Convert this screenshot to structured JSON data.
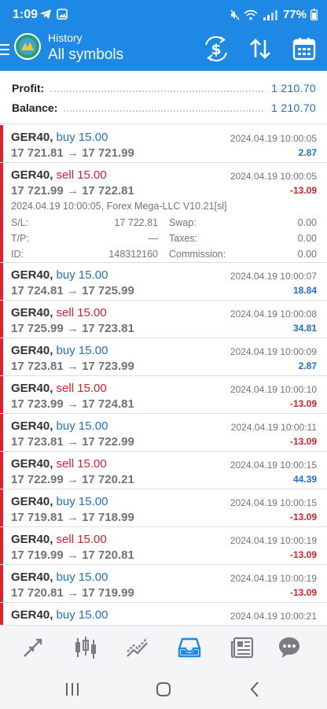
{
  "status_bar": {
    "time": "1:09",
    "battery": "77%"
  },
  "app_bar": {
    "section": "History",
    "title": "All symbols"
  },
  "summary": {
    "profit_label": "Profit:",
    "profit_value": "1 210.70",
    "balance_label": "Balance:",
    "balance_value": "1 210.70"
  },
  "deals": [
    {
      "symbol": "GER40,",
      "side": "buy 15.00",
      "prices": "17 721.81 → 17 721.99",
      "time": "2024.04.19 10:00:05",
      "profit": "2.87"
    },
    {
      "symbol": "GER40,",
      "side": "sell 15.00",
      "prices": "17 721.99 → 17 722.81",
      "time": "2024.04.19 10:00:05",
      "profit": "-13.09",
      "details": {
        "info": "2024.04.19 10:00:05, Forex Mega-LLC V10.21[sl]",
        "sl_label": "S/L:",
        "sl_value": "17 722.81",
        "tp_label": "T/P:",
        "tp_value": "—",
        "id_label": "ID:",
        "id_value": "148312160",
        "swap_label": "Swap:",
        "swap_value": "0.00",
        "taxes_label": "Taxes:",
        "taxes_value": "0.00",
        "commission_label": "Commission:",
        "commission_value": "0.00"
      }
    },
    {
      "symbol": "GER40,",
      "side": "buy 15.00",
      "prices": "17 724.81 → 17 725.99",
      "time": "2024.04.19 10:00:07",
      "profit": "18.84"
    },
    {
      "symbol": "GER40,",
      "side": "sell 15.00",
      "prices": "17 725.99 → 17 723.81",
      "time": "2024.04.19 10:00:08",
      "profit": "34.81"
    },
    {
      "symbol": "GER40,",
      "side": "buy 15.00",
      "prices": "17 723.81 → 17 723.99",
      "time": "2024.04.19 10:00:09",
      "profit": "2.87"
    },
    {
      "symbol": "GER40,",
      "side": "sell 15.00",
      "prices": "17 723.99 → 17 724.81",
      "time": "2024.04.19 10:00:10",
      "profit": "-13.09"
    },
    {
      "symbol": "GER40,",
      "side": "buy 15.00",
      "prices": "17 723.81 → 17 722.99",
      "time": "2024.04.19 10:00:11",
      "profit": "-13.09"
    },
    {
      "symbol": "GER40,",
      "side": "sell 15.00",
      "prices": "17 722.99 → 17 720.21",
      "time": "2024.04.19 10:00:15",
      "profit": "44.39"
    },
    {
      "symbol": "GER40,",
      "side": "buy 15.00",
      "prices": "17 719.81 → 17 718.99",
      "time": "2024.04.19 10:00:15",
      "profit": "-13.09"
    },
    {
      "symbol": "GER40,",
      "side": "sell 15.00",
      "prices": "17 719.99 → 17 720.81",
      "time": "2024.04.19 10:00:19",
      "profit": "-13.09"
    },
    {
      "symbol": "GER40,",
      "side": "buy 15.00",
      "prices": "17 720.81 → 17 719.99",
      "time": "2024.04.19 10:00:19",
      "profit": "-13.09"
    },
    {
      "symbol": "GER40,",
      "side": "buy 15.00",
      "prices": "",
      "time": "2024.04.19 10:00:21",
      "profit": ""
    }
  ],
  "colors": {
    "accent": "#1e88e5",
    "profit_positive": "#1e6fd0",
    "profit_negative": "#d3232b",
    "deal_marker": "#e0202a"
  },
  "icons": {
    "toolbar": [
      "trade-arrows-icon",
      "candlestick-chart-icon",
      "trend-chart-icon",
      "history-inbox-icon",
      "news-icon",
      "chat-icon"
    ],
    "app_bar": [
      "currency-exchange-icon",
      "sort-arrows-icon",
      "calendar-icon"
    ],
    "navigation": [
      "recent-apps-icon",
      "home-icon",
      "back-icon"
    ]
  }
}
